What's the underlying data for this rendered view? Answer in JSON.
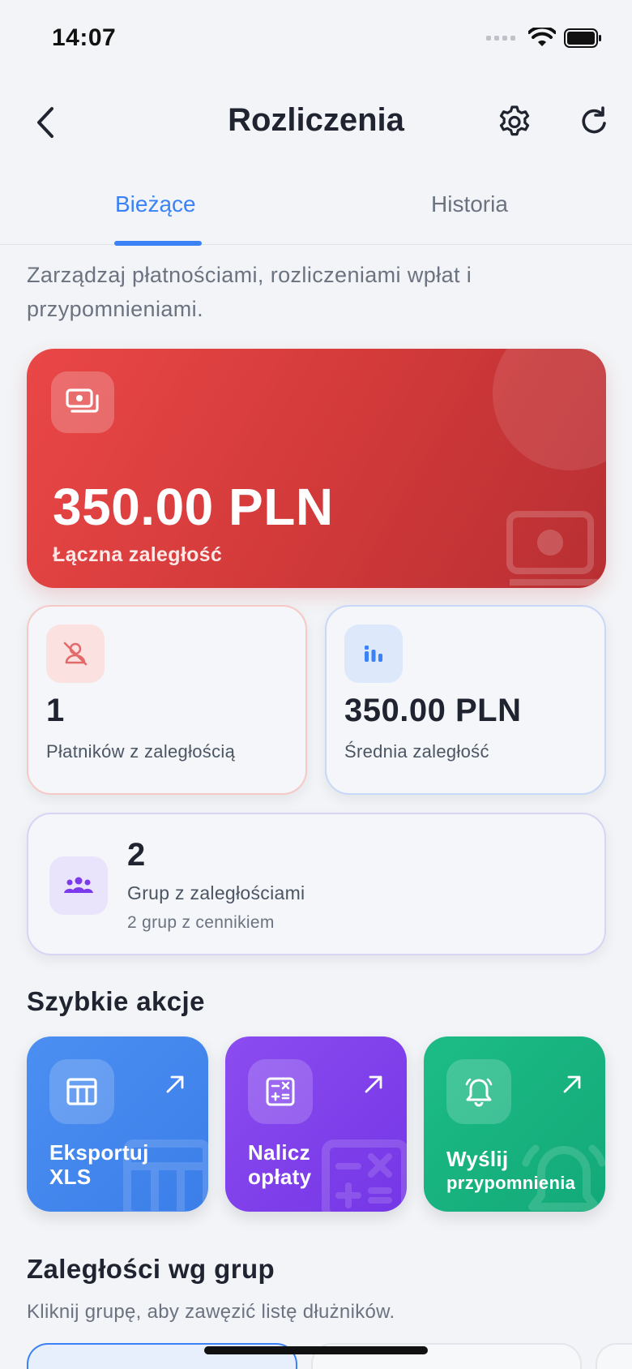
{
  "status_bar": {
    "time": "14:07"
  },
  "nav": {
    "title": "Rozliczenia"
  },
  "tabs": [
    {
      "label": "Bieżące",
      "active": true
    },
    {
      "label": "Historia",
      "active": false
    }
  ],
  "intro": "Zarządzaj płatnościami, rozliczeniami wpłat i przypomnieniami.",
  "summary": {
    "total_amount": "350.00 PLN",
    "total_label": "Łączna zaległość"
  },
  "stats": {
    "payers_value": "1",
    "payers_label": "Płatników z zaległością",
    "average_value": "350.00 PLN",
    "average_label": "Średnia zaległość",
    "groups_value": "2",
    "groups_label": "Grup z zaległościami",
    "groups_sub": "2 grup z cennikiem"
  },
  "quick_actions": {
    "title": "Szybkie akcje",
    "items": [
      {
        "label_line1": "Eksportuj",
        "label_line2": "XLS",
        "color": "#3b82f6",
        "icon": "table-icon"
      },
      {
        "label_line1": "Nalicz",
        "label_line2": "opłaty",
        "color": "#7c3aed",
        "icon": "calculator-icon"
      },
      {
        "label_line1": "Wyślij",
        "label_line2": "przypomnienia",
        "color": "#10b981",
        "icon": "bell-icon"
      }
    ]
  },
  "groups_section": {
    "title": "Zaległości wg grup",
    "subtitle": "Kliknij grupę, aby zawęzić listę dłużników."
  },
  "colors": {
    "accent": "#3b82f6",
    "danger": "#e24545",
    "success": "#10b981",
    "purple": "#7c3aed"
  }
}
